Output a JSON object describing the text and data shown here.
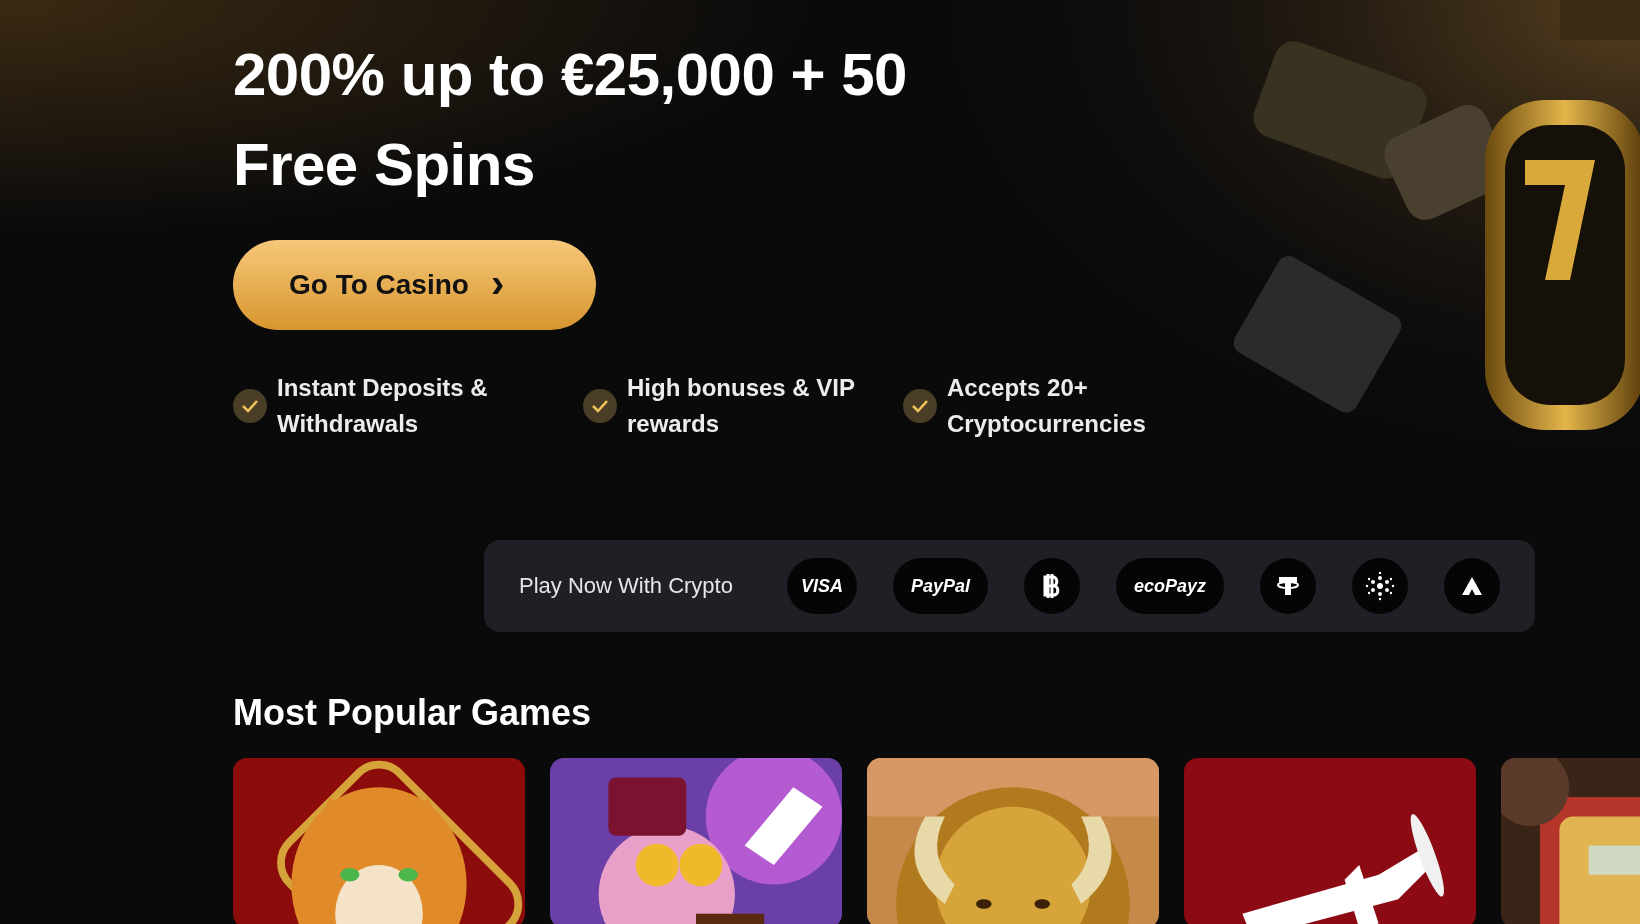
{
  "hero": {
    "title_lines": [
      "200% up to €25,000 + 50",
      "Free Spins"
    ],
    "cta": {
      "label": "Go To Casino",
      "icon": "›"
    },
    "features": [
      {
        "text": "Instant Deposits & Withdrawals"
      },
      {
        "text": "High bonuses & VIP rewards"
      },
      {
        "text": "Accepts 20+ Cryptocurrencies"
      }
    ]
  },
  "payments": {
    "label": "Play Now With Crypto",
    "methods": [
      {
        "kind": "label",
        "text": "VISA"
      },
      {
        "kind": "label",
        "text": "PayPal"
      },
      {
        "kind": "icon"
      },
      {
        "kind": "label",
        "text": "ecoPayz"
      },
      {
        "kind": "icon"
      },
      {
        "kind": "icon"
      },
      {
        "kind": "icon"
      }
    ]
  },
  "popular_games": {
    "heading": "Most Popular Games"
  }
}
